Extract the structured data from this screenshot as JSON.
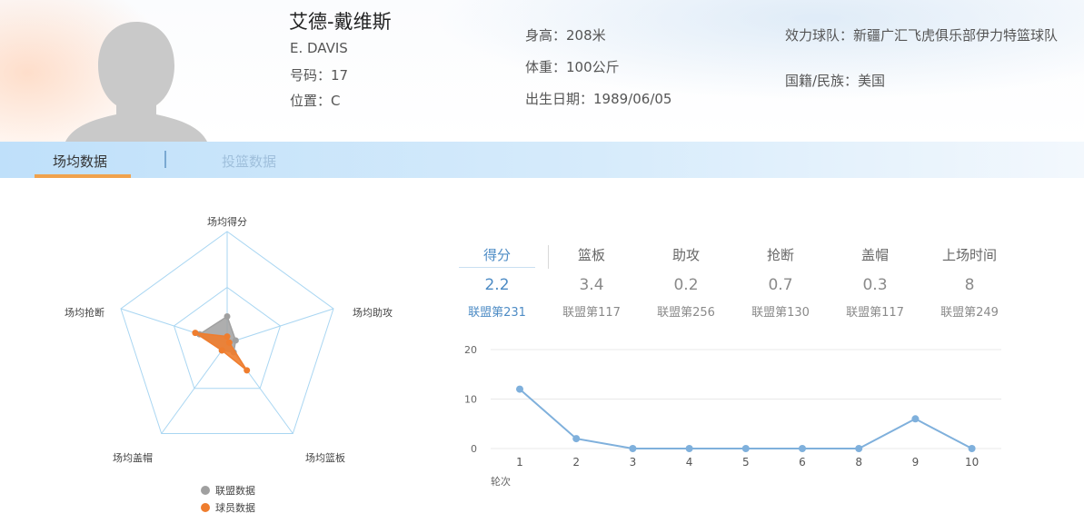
{
  "player": {
    "name": "艾德-戴维斯",
    "en_name": "E. DAVIS",
    "number": "号码：17",
    "position": "位置：C",
    "height": "身高：208米",
    "weight": "体重：100公斤",
    "birth": "出生日期：1989/06/05",
    "team": "效力球队：新疆广汇飞虎俱乐部伊力特篮球队",
    "nationality": "国籍/民族：美国"
  },
  "tabs": [
    {
      "label": "场均数据",
      "active": true
    },
    {
      "label": "投篮数据",
      "active": false
    }
  ],
  "colors": {
    "accent_orange": "#f0a24c",
    "player_series": "#ef7d2e",
    "league_series": "#a0a0a0",
    "line_series": "#7fb0dc",
    "active_blue": "#4e8cc5"
  },
  "radar": {
    "axes": [
      "场均得分",
      "场均助攻",
      "场均篮板",
      "场均盖帽",
      "场均抢断"
    ],
    "legend": [
      {
        "label": "联盟数据",
        "color": "#a0a0a0"
      },
      {
        "label": "球员数据",
        "color": "#ef7d2e"
      }
    ]
  },
  "stats": [
    {
      "label": "得分",
      "value": "2.2",
      "rank": "联盟第231",
      "active": true
    },
    {
      "label": "篮板",
      "value": "3.4",
      "rank": "联盟第117",
      "active": false
    },
    {
      "label": "助攻",
      "value": "0.2",
      "rank": "联盟第256",
      "active": false
    },
    {
      "label": "抢断",
      "value": "0.7",
      "rank": "联盟第130",
      "active": false
    },
    {
      "label": "盖帽",
      "value": "0.3",
      "rank": "联盟第117",
      "active": false
    },
    {
      "label": "上场时间",
      "value": "8",
      "rank": "联盟第249",
      "active": false
    }
  ],
  "chart_data": [
    {
      "type": "radar",
      "axes": [
        "场均得分",
        "场均助攻",
        "场均篮板",
        "场均盖帽",
        "场均抢断"
      ],
      "series": [
        {
          "name": "联盟数据",
          "values": [
            0.24,
            0.08,
            0.1,
            0.08,
            0.26
          ]
        },
        {
          "name": "球员数据",
          "values": [
            0.06,
            0.02,
            0.3,
            0.08,
            0.3
          ]
        }
      ],
      "range": [
        0,
        1
      ],
      "legend_position": "bottom"
    },
    {
      "type": "line",
      "x": [
        "1",
        "2",
        "3",
        "4",
        "5",
        "6",
        "8",
        "9",
        "10"
      ],
      "values": [
        12,
        2,
        0,
        0,
        0,
        0,
        0,
        6,
        0
      ],
      "xlabel": "轮次",
      "ylabel": "",
      "ylim": [
        0,
        20
      ],
      "yticks": [
        "0",
        "10",
        "20"
      ],
      "grid": true
    }
  ]
}
